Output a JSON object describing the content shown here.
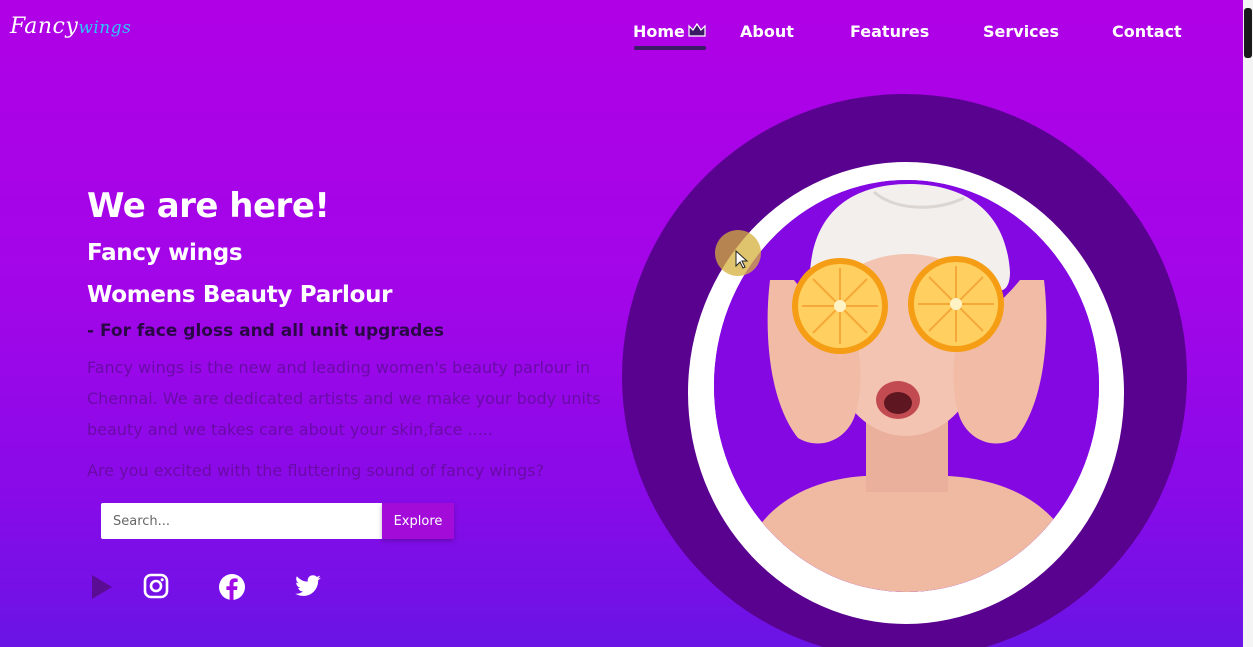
{
  "header": {
    "logo_primary": "Fancy",
    "logo_accent": "wings"
  },
  "nav": {
    "items": [
      {
        "label": "Home",
        "active": true
      },
      {
        "label": "About"
      },
      {
        "label": "Features"
      },
      {
        "label": "Services"
      },
      {
        "label": "Contact"
      }
    ],
    "active_icon": "crown-icon"
  },
  "hero": {
    "title": "We are here!",
    "subtitle_1": "Fancy wings",
    "subtitle_2": "Womens Beauty Parlour",
    "tagline": "- For face gloss and all unit upgrades",
    "description": "Fancy wings is the new and leading women's beauty parlour in Chennai. We are dedicated artists and we make your body units beauty and we takes care about your skin,face .....",
    "question": "Are you excited with the fluttering sound of fancy wings?"
  },
  "search": {
    "placeholder": "Search...",
    "button_label": "Explore"
  },
  "social": [
    "play-icon",
    "instagram-icon",
    "facebook-icon",
    "twitter-icon"
  ],
  "image": {
    "subject": "woman-holding-orange-slices-photo"
  },
  "colors": {
    "background_top": "#b000e6",
    "background_bottom": "#6a14e6",
    "circle": "#5a0290",
    "button": "#a20bd8",
    "logo_accent": "#2cc7ff",
    "tagline": "#2a0845",
    "body_text": "#6a0ba8"
  }
}
